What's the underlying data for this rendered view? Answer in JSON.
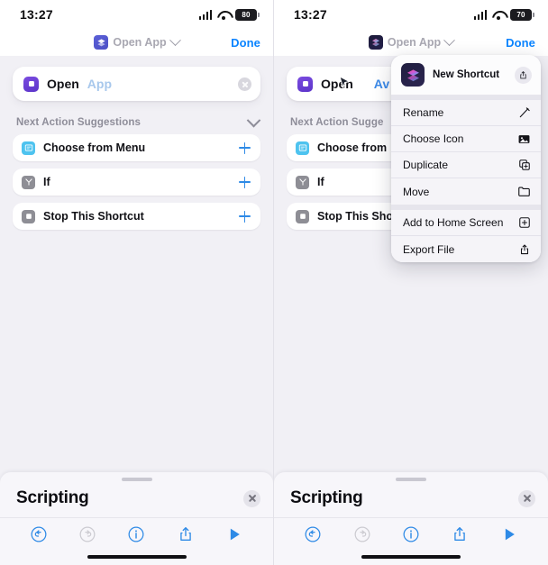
{
  "panels": [
    {
      "id": "panel-left",
      "status": {
        "time": "13:27",
        "battery": "80",
        "signal_icon": "cellular-bars-icon",
        "wifi_icon": "wifi-icon"
      },
      "navbar": {
        "icon": "shortcut-app-icon",
        "title": "Open App",
        "chevron": "chevron-down-icon",
        "done_label": "Done"
      },
      "action": {
        "icon": "open-app-icon",
        "word": "Open",
        "param": "App",
        "param_is_link": false,
        "clear_icon": "clear-circle-icon",
        "cursor": false
      },
      "suggestions_header": {
        "title": "Next Action Suggestions",
        "collapse_icon": "chevron-down-icon"
      },
      "suggestions": [
        {
          "label": "Choose from Menu",
          "icon": "menu-list-icon",
          "icon_style": "menu",
          "add_icon": "plus-icon"
        },
        {
          "label": "If",
          "icon": "branch-icon",
          "icon_style": "gray",
          "add_icon": "plus-icon"
        },
        {
          "label": "Stop This Shortcut",
          "icon": "stop-square-icon",
          "icon_style": "gray",
          "add_icon": "plus-icon"
        }
      ],
      "sheet": {
        "title": "Scripting",
        "close_icon": "close-circle-icon",
        "grabber": "sheet-grabber",
        "tools": [
          {
            "name": "undo-icon",
            "state": "enabled"
          },
          {
            "name": "redo-icon",
            "state": "disabled"
          },
          {
            "name": "info-icon",
            "state": "enabled"
          },
          {
            "name": "share-icon",
            "state": "enabled"
          },
          {
            "name": "play-icon",
            "state": "enabled"
          }
        ]
      },
      "menu": null
    },
    {
      "id": "panel-right",
      "status": {
        "time": "13:27",
        "battery": "70",
        "signal_icon": "cellular-bars-icon",
        "wifi_icon": "wifi-icon"
      },
      "navbar": {
        "icon": "shortcut-app-icon-gradient",
        "title": "Open App",
        "chevron": "chevron-down-icon",
        "done_label": "Done"
      },
      "action": {
        "icon": "open-app-icon",
        "word": "Open",
        "param": "Av",
        "param_is_link": true,
        "clear_icon": "clear-circle-icon",
        "cursor": true
      },
      "suggestions_header": {
        "title": "Next Action Sugge",
        "collapse_icon": "chevron-down-icon"
      },
      "suggestions": [
        {
          "label": "Choose from",
          "icon": "menu-list-icon",
          "icon_style": "menu",
          "add_icon": "plus-icon"
        },
        {
          "label": "If",
          "icon": "branch-icon",
          "icon_style": "gray",
          "add_icon": "plus-icon"
        },
        {
          "label": "Stop This Sho",
          "icon": "stop-square-icon",
          "icon_style": "gray",
          "add_icon": "plus-icon"
        }
      ],
      "sheet": {
        "title": "Scripting",
        "close_icon": "close-icon",
        "grabber": "sheet-grabber",
        "tools": [
          {
            "name": "undo-icon",
            "state": "enabled"
          },
          {
            "name": "redo-icon",
            "state": "disabled"
          },
          {
            "name": "info-icon",
            "state": "enabled"
          },
          {
            "name": "share-icon",
            "state": "enabled"
          },
          {
            "name": "play-icon",
            "state": "enabled"
          }
        ]
      },
      "menu": {
        "header": {
          "app_name": "New Shortcut",
          "app_icon": "shortcuts-app-icon",
          "share_icon": "share-icon"
        },
        "groups": [
          [
            {
              "label": "Rename",
              "icon": "pencil-icon"
            },
            {
              "label": "Choose Icon",
              "icon": "photo-icon"
            },
            {
              "label": "Duplicate",
              "icon": "duplicate-icon"
            },
            {
              "label": "Move",
              "icon": "folder-icon"
            }
          ],
          [
            {
              "label": "Add to Home Screen",
              "icon": "plus-square-icon"
            },
            {
              "label": "Export File",
              "icon": "share-icon"
            }
          ]
        ]
      }
    }
  ],
  "colors": {
    "accent_blue": "#0a84ff",
    "background": "#f1f0f5",
    "card": "#ffffff",
    "menu_bg": "#f5f4f8",
    "suggestion_icon_cyan": "#4ec3ef",
    "suggestion_icon_gray": "#8e8e95",
    "app_icon_purple": "#5b34c9"
  }
}
